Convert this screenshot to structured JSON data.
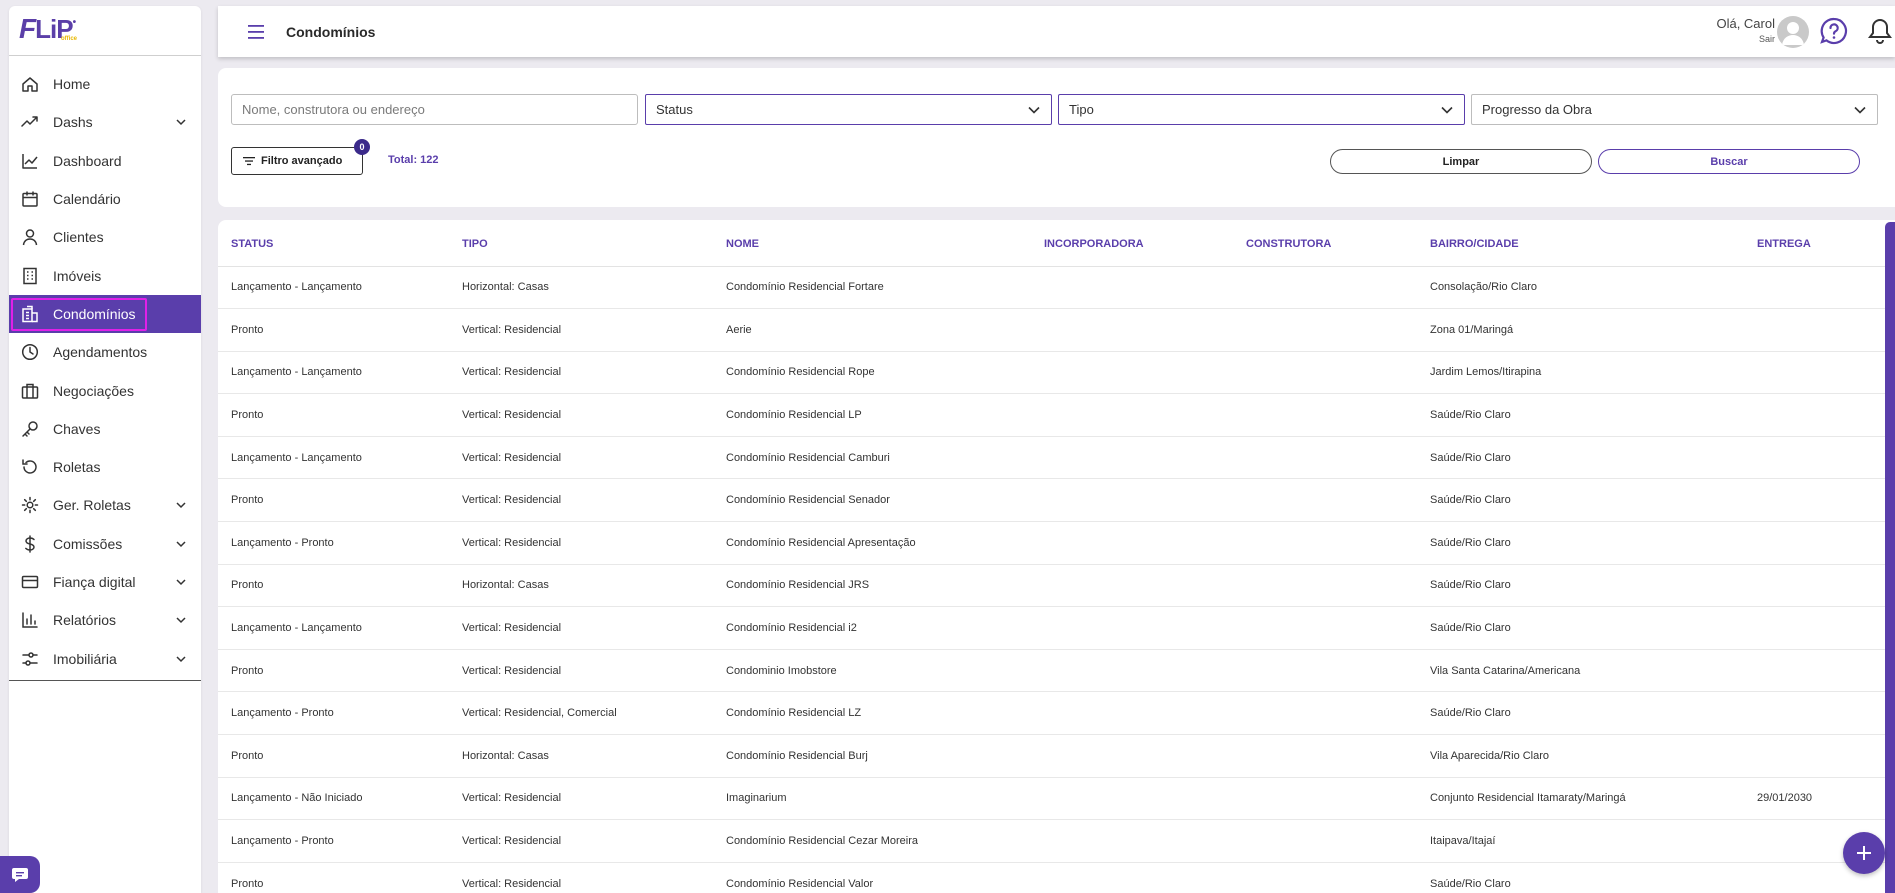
{
  "app": {
    "logo_text": "FLIP",
    "logo_sub": "office"
  },
  "header": {
    "title": "Condomínios",
    "greeting": "Olá, Carol",
    "logout": "Sair"
  },
  "sidebar": {
    "items": [
      {
        "label": "Home",
        "icon": "home-icon",
        "chevron": false,
        "active": false
      },
      {
        "label": "Dashs",
        "icon": "trend-icon",
        "chevron": true,
        "active": false
      },
      {
        "label": "Dashboard",
        "icon": "line-chart-icon",
        "chevron": false,
        "active": false
      },
      {
        "label": "Calendário",
        "icon": "calendar-icon",
        "chevron": false,
        "active": false
      },
      {
        "label": "Clientes",
        "icon": "user-icon",
        "chevron": false,
        "active": false
      },
      {
        "label": "Imóveis",
        "icon": "building-icon",
        "chevron": false,
        "active": false
      },
      {
        "label": "Condomínios",
        "icon": "condo-icon",
        "chevron": false,
        "active": true
      },
      {
        "label": "Agendamentos",
        "icon": "clock-icon",
        "chevron": false,
        "active": false
      },
      {
        "label": "Negociações",
        "icon": "briefcase-icon",
        "chevron": false,
        "active": false
      },
      {
        "label": "Chaves",
        "icon": "key-icon",
        "chevron": false,
        "active": false
      },
      {
        "label": "Roletas",
        "icon": "rotate-icon",
        "chevron": false,
        "active": false
      },
      {
        "label": "Ger. Roletas",
        "icon": "gear-icon",
        "chevron": true,
        "active": false
      },
      {
        "label": "Comissões",
        "icon": "dollar-icon",
        "chevron": true,
        "active": false
      },
      {
        "label": "Fiança digital",
        "icon": "card-icon",
        "chevron": true,
        "active": false
      },
      {
        "label": "Relatórios",
        "icon": "bar-chart-icon",
        "chevron": true,
        "active": false
      },
      {
        "label": "Imobiliária",
        "icon": "sliders-icon",
        "chevron": true,
        "active": false
      }
    ]
  },
  "filters": {
    "search_placeholder": "Nome, construtora ou endereço",
    "status_label": "Status",
    "tipo_label": "Tipo",
    "progresso_label": "Progresso da Obra",
    "advanced_label": "Filtro avançado",
    "advanced_count": "0",
    "total_label": "Total: 122",
    "clear_label": "Limpar",
    "search_label": "Buscar"
  },
  "table": {
    "headers": [
      "STATUS",
      "TIPO",
      "NOME",
      "INCORPORADORA",
      "CONSTRUTORA",
      "BAIRRO/CIDADE",
      "ENTREGA"
    ],
    "rows": [
      [
        "Lançamento - Lançamento",
        "Horizontal: Casas",
        "Condomínio Residencial Fortare",
        "",
        "",
        "Consolação/Rio Claro",
        ""
      ],
      [
        "Pronto",
        "Vertical: Residencial",
        "Aerie",
        "",
        "",
        "Zona 01/Maringá",
        ""
      ],
      [
        "Lançamento - Lançamento",
        "Vertical: Residencial",
        "Condomínio Residencial Rope",
        "",
        "",
        "Jardim Lemos/Itirapina",
        ""
      ],
      [
        "Pronto",
        "Vertical: Residencial",
        "Condomínio Residencial LP",
        "",
        "",
        "Saúde/Rio Claro",
        ""
      ],
      [
        "Lançamento - Lançamento",
        "Vertical: Residencial",
        "Condomínio Residencial Camburi",
        "",
        "",
        "Saúde/Rio Claro",
        ""
      ],
      [
        "Pronto",
        "Vertical: Residencial",
        "Condomínio Residencial Senador",
        "",
        "",
        "Saúde/Rio Claro",
        ""
      ],
      [
        "Lançamento - Pronto",
        "Vertical: Residencial",
        "Condomínio Residencial Apresentação",
        "",
        "",
        "Saúde/Rio Claro",
        ""
      ],
      [
        "Pronto",
        "Horizontal: Casas",
        "Condomínio Residencial JRS",
        "",
        "",
        "Saúde/Rio Claro",
        ""
      ],
      [
        "Lançamento - Lançamento",
        "Vertical: Residencial",
        "Condomínio Residencial i2",
        "",
        "",
        "Saúde/Rio Claro",
        ""
      ],
      [
        "Pronto",
        "Vertical: Residencial",
        "Condominio Imobstore",
        "",
        "",
        "Vila Santa Catarina/Americana",
        ""
      ],
      [
        "Lançamento - Pronto",
        "Vertical: Residencial, Comercial",
        "Condomínio Residencial LZ",
        "",
        "",
        "Saúde/Rio Claro",
        ""
      ],
      [
        "Pronto",
        "Horizontal: Casas",
        "Condomínio Residencial Burj",
        "",
        "",
        "Vila Aparecida/Rio Claro",
        ""
      ],
      [
        "Lançamento - Não Iniciado",
        "Vertical: Residencial",
        "Imaginarium",
        "",
        "",
        "Conjunto Residencial Itamaraty/Maringá",
        "29/01/2030"
      ],
      [
        "Lançamento - Pronto",
        "Vertical: Residencial",
        "Condomínio Residencial Cezar Moreira",
        "",
        "",
        "Itaipava/Itajaí",
        ""
      ],
      [
        "Pronto",
        "Vertical: Residencial",
        "Condomínio Residencial Valor",
        "",
        "",
        "Saúde/Rio Claro",
        ""
      ]
    ]
  },
  "colors": {
    "accent": "#5a3eab",
    "active_outline": "#e020e8",
    "badge": "#3b2a8a"
  }
}
